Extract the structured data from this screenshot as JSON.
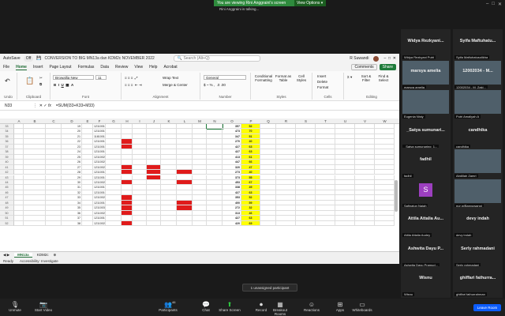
{
  "zoom": {
    "share_banner": "You are viewing Rini Anggraini's screen",
    "view_options": "View Options",
    "sharer_caption": "Rini Anggraini is talking...",
    "toolbar": [
      {
        "label": "Unmute",
        "icon": "microphone-muted-icon"
      },
      {
        "label": "Start Video",
        "icon": "video-off-icon"
      },
      {
        "label": "Participants",
        "icon": "participants-icon",
        "count": "46"
      },
      {
        "label": "Chat",
        "icon": "chat-icon"
      },
      {
        "label": "Share Screen",
        "icon": "share-screen-icon"
      },
      {
        "label": "Record",
        "icon": "record-icon"
      },
      {
        "label": "Breakout Rooms",
        "icon": "breakout-rooms-icon"
      },
      {
        "label": "Reactions",
        "icon": "reactions-icon"
      },
      {
        "label": "Apps",
        "icon": "apps-icon"
      },
      {
        "label": "Whiteboards",
        "icon": "whiteboard-icon"
      }
    ],
    "leave_label": "Leave Room",
    "toast": "1 unassigned participant",
    "participants": [
      {
        "name": "Widya Rezkyani...",
        "sub": "Widya Rezkyani Putri"
      },
      {
        "name": "Syifa Maftuhatu...",
        "sub": "Syifa Maftuhatusolikha"
      },
      {
        "name": "marsya amelia",
        "sub": "marsya amelia",
        "video": true
      },
      {
        "name": "12002034 - M...",
        "sub": "12002034 - M. Zaki...",
        "video": true
      },
      {
        "name": "",
        "sub": "Eugenia Nisty",
        "video": true
      },
      {
        "name": "",
        "sub": "Putri Amaliyah A",
        "video": true
      },
      {
        "name": "_Satya sumunari...",
        "sub": "_Satya sumunaring_1..."
      },
      {
        "name": "candhika",
        "sub": "candhika"
      },
      {
        "name": "fadhil",
        "sub": "fadhil"
      },
      {
        "name": "",
        "sub": "Abdillah Zamri",
        "video": true
      },
      {
        "name": "",
        "sub": "Safinatun Najah",
        "avatar": "S"
      },
      {
        "name": "",
        "sub": "nur w/Banyuwangi",
        "video": true
      },
      {
        "name": "Attila Attalia Au...",
        "sub": "Attila Attalia Audey"
      },
      {
        "name": "devy indah",
        "sub": "devy indah"
      },
      {
        "name": "Ashwita Dayu P...",
        "sub": "Ashwita Dayu Pramud..."
      },
      {
        "name": "Serly rahmadani",
        "sub": "Serly rahmadani"
      },
      {
        "name": "Wisnu",
        "sub": "Wisnu"
      },
      {
        "name": "ghiffari fathurra...",
        "sub": "ghiffari fathurrahman"
      }
    ]
  },
  "excel": {
    "autosave": "AutoSave",
    "autosave_state": "Off",
    "filename": "CONVERSION TO BIG MN13a dan KDM2c NOVEMBER 2022",
    "search": "Search (Alt+Q)",
    "user": "R Suwandi",
    "menus": [
      "File",
      "Home",
      "Insert",
      "Page Layout",
      "Formulas",
      "Data",
      "Review",
      "View",
      "Help",
      "Acrobat"
    ],
    "active_menu": "Home",
    "comments": "Comments",
    "share": "Share",
    "ribbon": {
      "font": "Browallia New",
      "size": "11",
      "wrap": "Wrap Text",
      "merge": "Merge & Center",
      "number_format": "General",
      "cf": "Conditional Formatting",
      "fat": "Format as Table",
      "cs": "Cell Styles",
      "insert": "Insert",
      "delete": "Delete",
      "format": "Format",
      "sort": "Sort & Filter",
      "find": "Find & Select",
      "groups": [
        "Undo",
        "Clipboard",
        "Font",
        "Alignment",
        "Number",
        "Styles",
        "Cells",
        "Editing"
      ]
    },
    "namebox": "N33",
    "formula": "=SUM(I33+K33+M33)",
    "columns": [
      "A",
      "B",
      "C",
      "D",
      "E",
      "F",
      "G",
      "H",
      "I",
      "J",
      "K",
      "L",
      "M",
      "N",
      "O",
      "P",
      "Q",
      "R",
      "S",
      "T",
      "U",
      "V",
      "W"
    ],
    "rows": [
      {
        "r": "33",
        "no": "19",
        "id": "1211001063",
        "o": "357",
        "p": "52"
      },
      {
        "r": "34",
        "no": "20",
        "id": "1211001092",
        "o": "473",
        "p": "70"
      },
      {
        "r": "35",
        "no": "21",
        "id": "1181001135",
        "o": "347",
        "p": "51"
      },
      {
        "r": "36",
        "no": "22",
        "id": "1211001046",
        "o": "270",
        "p": "40"
      },
      {
        "r": "37",
        "no": "23",
        "id": "1211001001",
        "o": "427",
        "p": "63"
      },
      {
        "r": "38",
        "no": "24",
        "id": "1211001025",
        "o": "427",
        "p": "63"
      },
      {
        "r": "39",
        "no": "25",
        "id": "1211002019",
        "o": "413",
        "p": "61"
      },
      {
        "r": "40",
        "no": "26",
        "id": "1211002080",
        "o": "447",
        "p": "66"
      },
      {
        "r": "41",
        "no": "27",
        "id": "1211002099",
        "o": "320",
        "p": "47"
      },
      {
        "r": "42",
        "no": "28",
        "id": "1211001094",
        "o": "273",
        "p": "40"
      },
      {
        "r": "43",
        "no": "29",
        "id": "1211001061",
        "o": "373",
        "p": "55"
      },
      {
        "r": "44",
        "no": "30",
        "id": "1211002017",
        "o": "453",
        "p": "67"
      },
      {
        "r": "45",
        "no": "31",
        "id": "1211001010",
        "o": "338",
        "p": "49"
      },
      {
        "r": "46",
        "no": "32",
        "id": "1211001061",
        "o": "427",
        "p": "63"
      },
      {
        "r": "47",
        "no": "33",
        "id": "1211002009",
        "o": "353",
        "p": "52"
      },
      {
        "r": "48",
        "no": "34",
        "id": "1211001064",
        "o": "400",
        "p": "59"
      },
      {
        "r": "49",
        "no": "35",
        "id": "1211003009",
        "o": "272",
        "p": "32"
      },
      {
        "r": "50",
        "no": "36",
        "id": "1211002021",
        "o": "313",
        "p": "46"
      },
      {
        "r": "51",
        "no": "37",
        "id": "1211001018",
        "o": "427",
        "p": "63"
      },
      {
        "r": "52",
        "no": "38",
        "id": "1211002044",
        "o": "420",
        "p": "69"
      }
    ],
    "sheets": [
      "MN13a",
      "KDM2c"
    ],
    "active_sheet": "MN13a",
    "status_ready": "Ready",
    "status_access": "Accessibility: Investigate"
  }
}
